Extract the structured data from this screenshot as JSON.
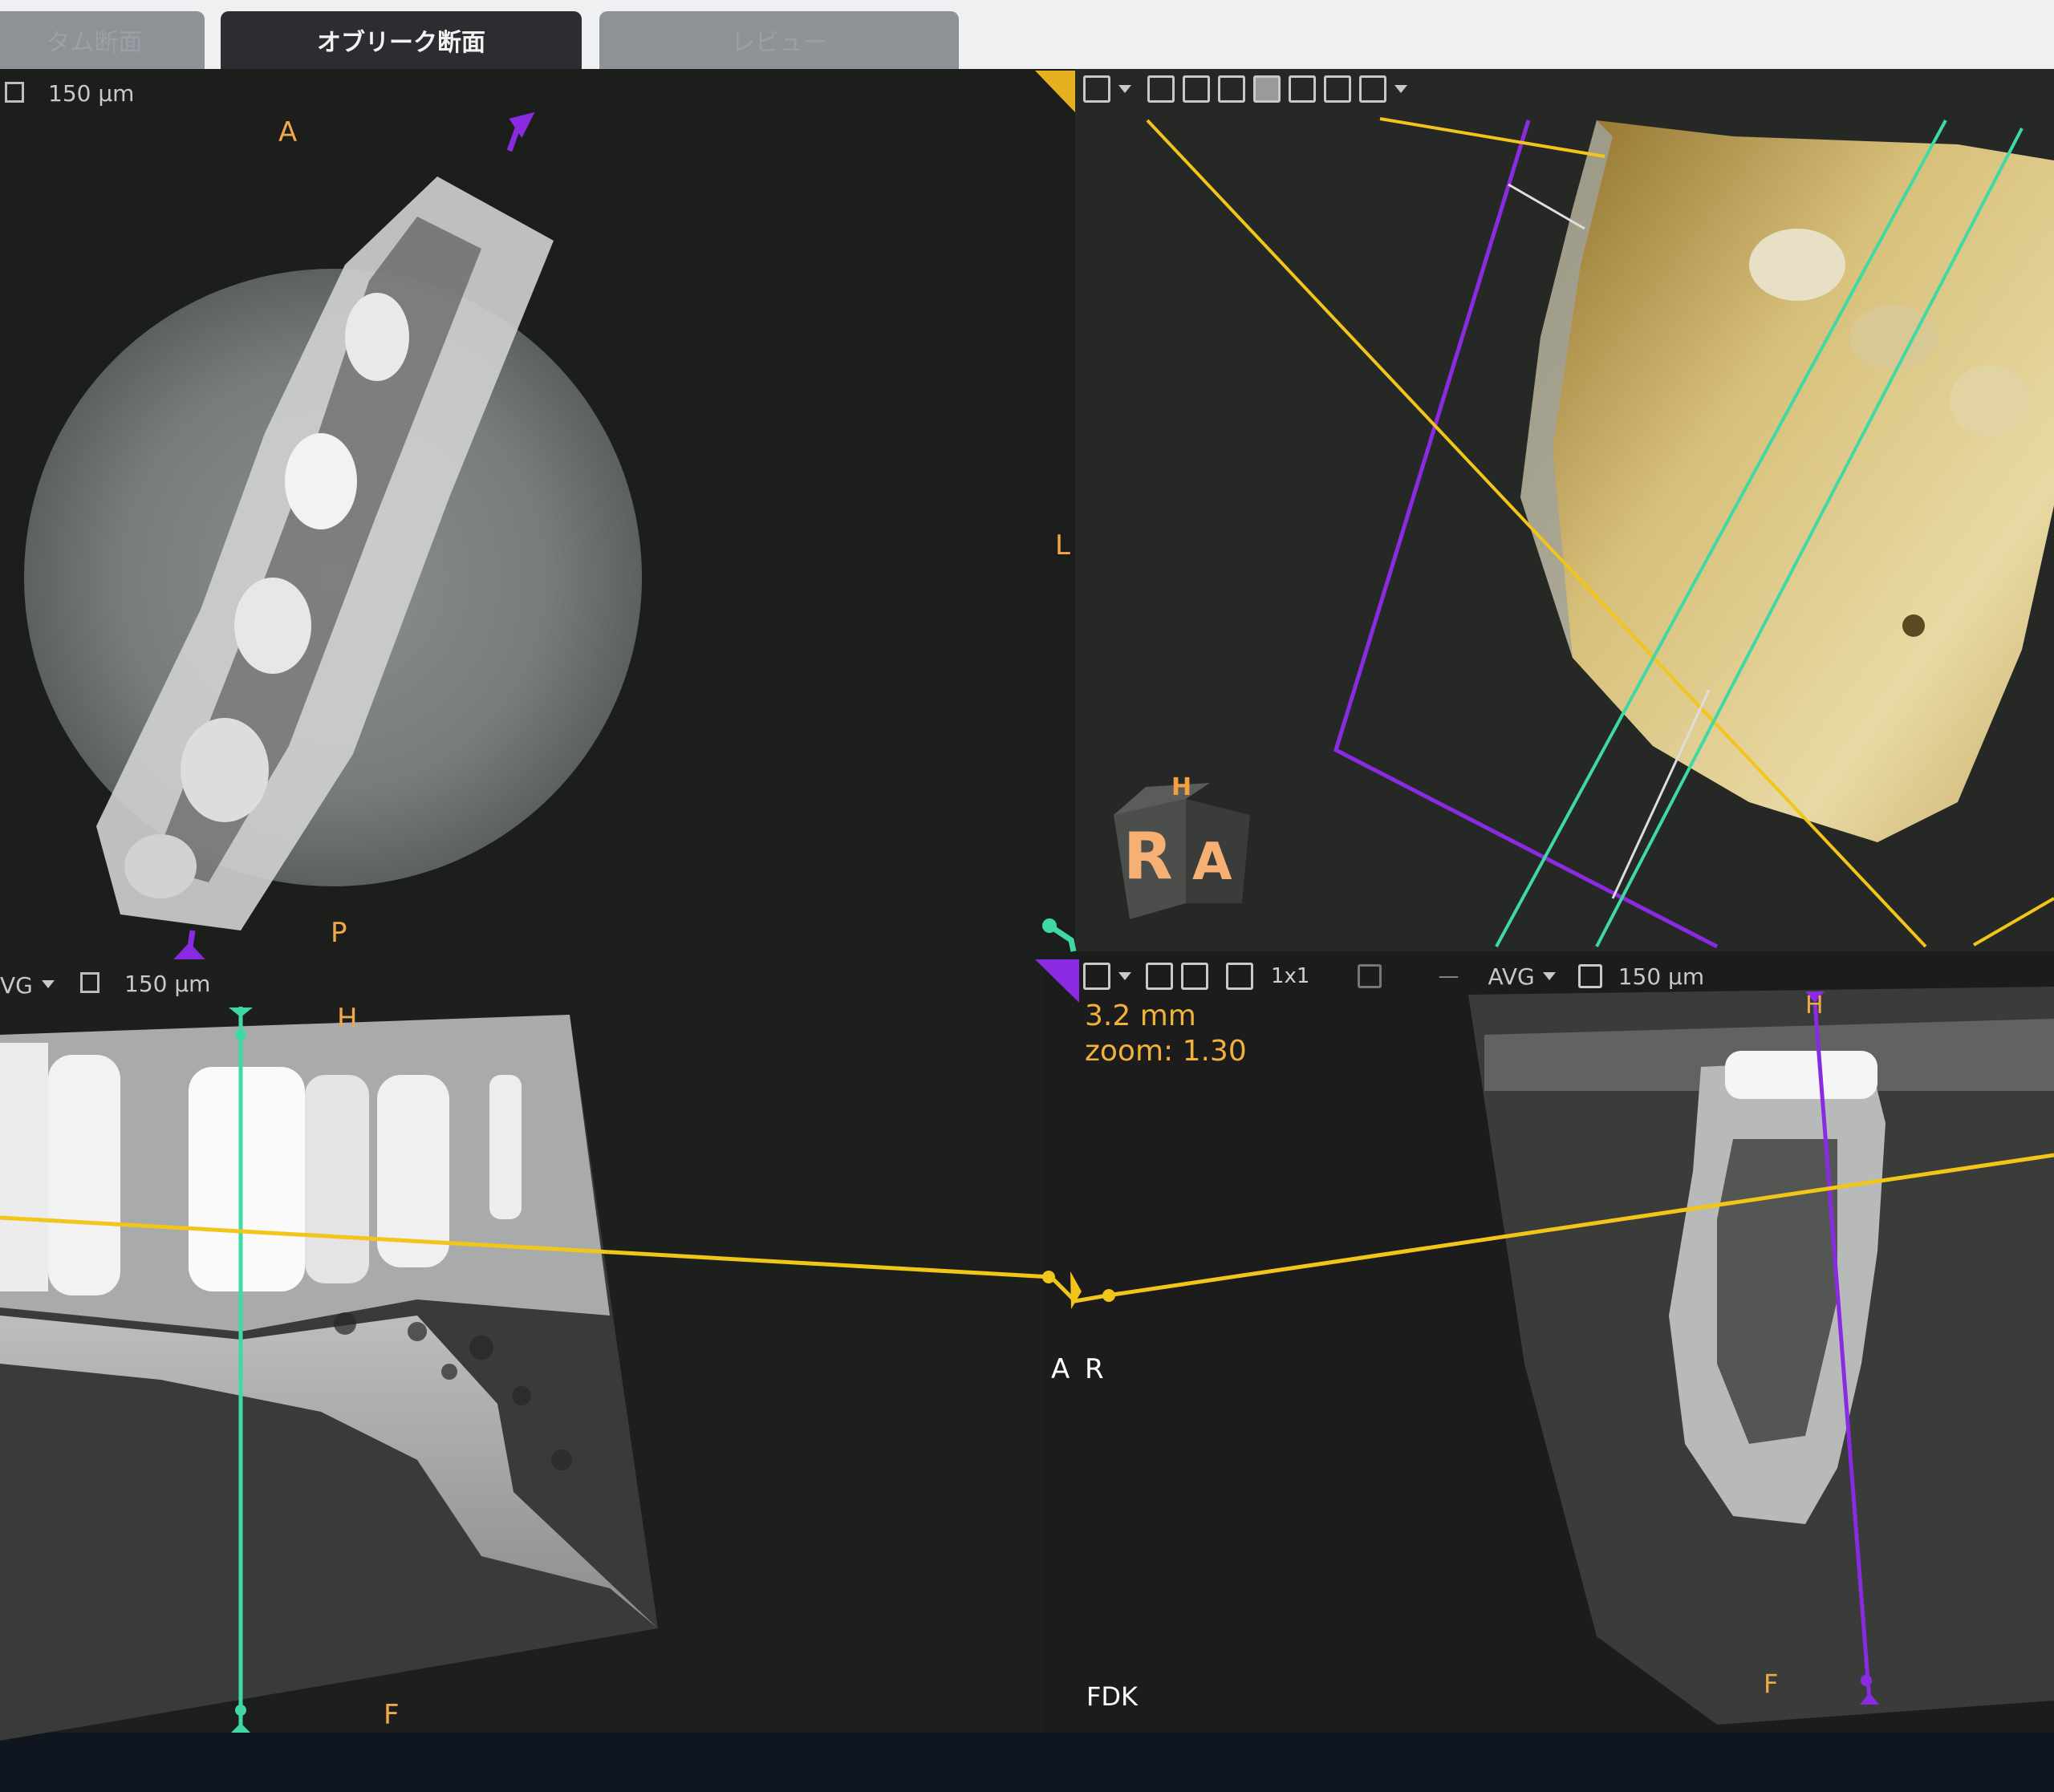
{
  "tabs": [
    {
      "label": "タム断面",
      "active": false
    },
    {
      "label": "オブリーク断面",
      "active": true
    },
    {
      "label": "レビュー",
      "active": false
    }
  ],
  "top_left": {
    "slice_thickness": "150 µm",
    "orient_top": "A",
    "orient_right": "L",
    "orient_bottom": "P"
  },
  "top_right": {
    "cube_front": "R",
    "cube_side": "A",
    "cube_top": "H",
    "icons": [
      "save-icon",
      "fit-icon",
      "reset-view-icon",
      "cube-view-icon",
      "cube-solid-icon",
      "cube-split-icon",
      "cube-grid-icon",
      "cube-outline-icon"
    ]
  },
  "bottom_left": {
    "mode": "VG",
    "slice_thickness": "150 µm",
    "orient_top": "H",
    "orient_bottom": "F"
  },
  "bottom_right": {
    "layout": "1x1",
    "separator": "—",
    "mode": "AVG",
    "slice_thickness": "150 µm",
    "measure": "3.2 mm",
    "zoom": "zoom: 1.30",
    "orient_top": "H",
    "orient_bottom": "F",
    "orient_a": "A",
    "orient_r": "R",
    "algorithm": "FDK"
  },
  "colors": {
    "yellow": "#f2c51a",
    "purple": "#8a2be2",
    "teal": "#3fd9a5",
    "label_orange": "#f0a848"
  }
}
